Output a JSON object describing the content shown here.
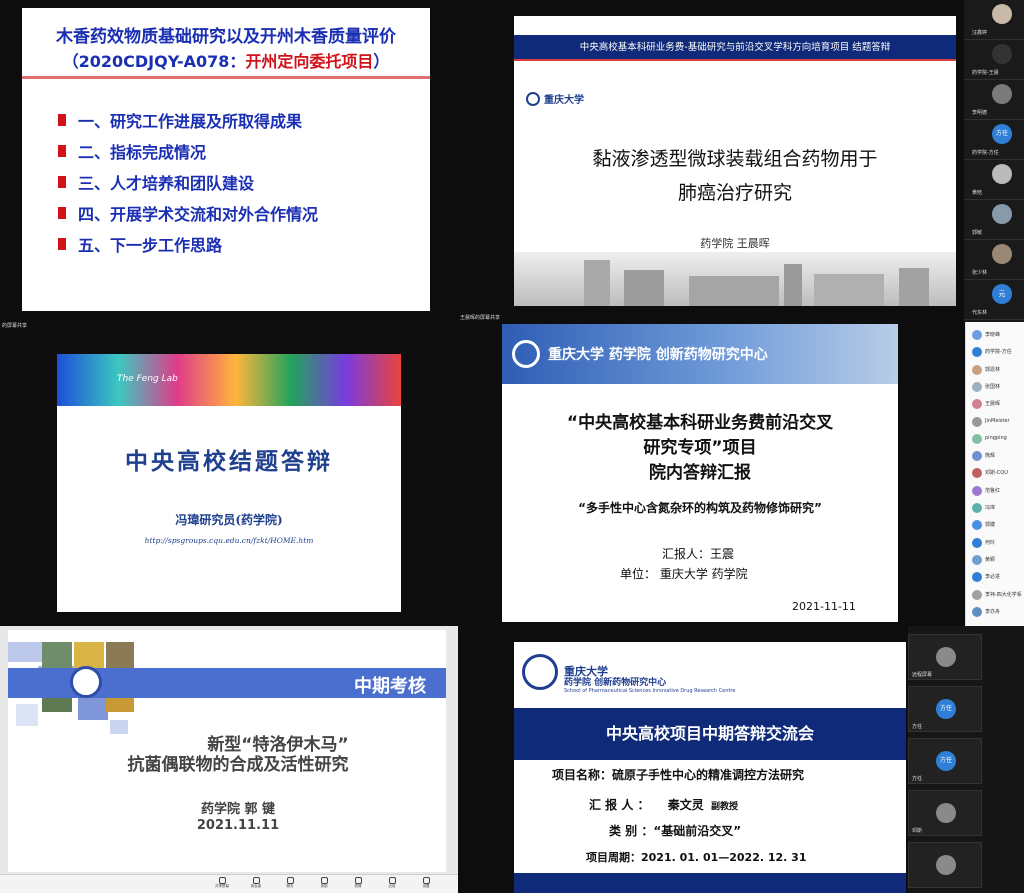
{
  "q1": {
    "title_line1": "木香药效物质基础研究以及开州木香质量评价",
    "title_code": "（2020CDJQY-A078：",
    "title_highlight": "开州定向委托项目",
    "title_end": "）",
    "items": [
      "一、研究工作进展及所取得成果",
      "二、指标完成情况",
      "三、人才培养和团队建设",
      "四、开展学术交流和对外合作情况",
      "五、下一步工作思路"
    ],
    "share_label": "的屏幕共享"
  },
  "q2": {
    "header": "中央高校基本科研业务费-基础研究与前沿交叉学科方向培育项目   结题答辩",
    "university": "重庆大学",
    "title_line1": "黏液渗透型微球装载组合药物用于",
    "title_line2": "肺癌治疗研究",
    "presenter": "药学院 王晨晖",
    "share_label": "王晨晖的屏幕共享"
  },
  "q2_side": {
    "names": [
      "汪鑫婷",
      "药学院-王晨",
      "李明德",
      "药学院-方任",
      "黄晗",
      "郭敏",
      "张少林",
      "代东林"
    ],
    "badge": "方任",
    "badge2": "元"
  },
  "q3": {
    "banner": "The Feng Lab",
    "title": "中央高校结题答辩",
    "presenter": "冯瑋研究员(药学院)",
    "url": "http://spsgroups.cqu.edu.cn/fzkt/HOME.htm"
  },
  "q4": {
    "banner_text": "重庆大学  药学院  创新药物研究中心",
    "title1": "“中央高校基本科研业务费前沿交叉",
    "title2": "研究专项”项目",
    "title3": "院内答辩汇报",
    "subtitle": "“多手性中心含氮杂环的构筑及药物修饰研究”",
    "reporter": "汇报人：王震",
    "unit": "单位：  重庆大学  药学院",
    "date": "2021-11-11"
  },
  "q4_list": [
    "李晓峰",
    "药学院-方任",
    "郭恩林",
    "张国林",
    "王晨晖",
    "JinMeister",
    "pingping",
    "熊辉",
    "邓斯-CQU",
    "范鲁红",
    "冯瑋",
    "郭键",
    "何玲",
    "黄颖",
    "李必进",
    "李祎-四大化学系",
    "李亦舟"
  ],
  "q5": {
    "banner": "中期考核",
    "title1": "新型“特洛伊木马”",
    "title2": "抗菌偶联物的合成及活性研究",
    "presenter": "药学院 郭 键",
    "date": "2021.11.11"
  },
  "q6": {
    "uni": "重庆大学",
    "school": "药学院  创新药物研究中心",
    "english": "School of Pharmaceutical Sciences  Innovative Drug Research Centre",
    "banner": "中央高校项目中期答辩交流会",
    "project_label": "项目名称：硫原子手性中心的精准调控方法研究",
    "reporter_label": "汇  报  人  ：",
    "reporter_name": "秦文灵",
    "reporter_title": "副教授",
    "category_label": "类     别  ：“基础前沿交叉”",
    "period": "项目周期：2021. 01. 01—2022. 12. 31"
  },
  "q6_side": {
    "badge1": "方任",
    "badge2": "方任",
    "names": [
      "远程屏幕",
      "方任",
      "方任",
      "邓斯"
    ]
  },
  "bottom_bar": [
    "共享屏幕",
    "参会者",
    "聊天",
    "录制",
    "表情",
    "应用",
    "设置"
  ],
  "colors": {
    "red": "#d2121b",
    "navy": "#0f2a78",
    "blue": "#1b2fb3",
    "bar_blue": "#4a6fcf"
  }
}
